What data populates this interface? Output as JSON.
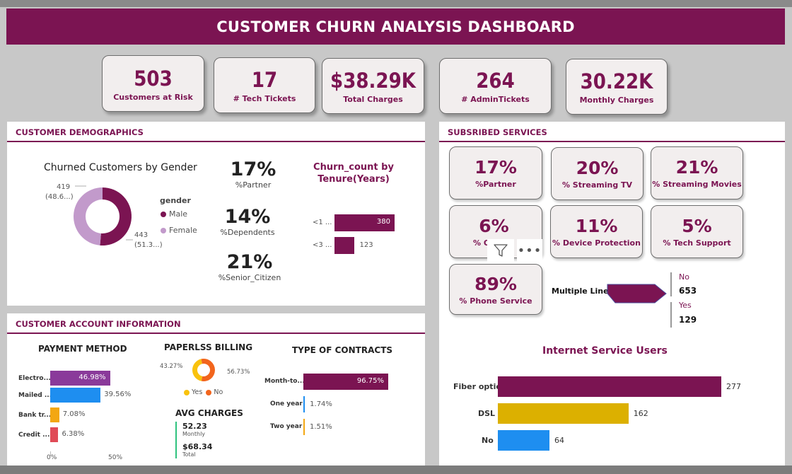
{
  "title": "CUSTOMER CHURN ANALYSIS DASHBOARD",
  "kpis": [
    {
      "value": "503",
      "label": "Customers at Risk"
    },
    {
      "value": "17",
      "label": "# Tech Tickets"
    },
    {
      "value": "$38.29K",
      "label": "Total Charges"
    },
    {
      "value": "264",
      "label": "# AdminTickets"
    },
    {
      "value": "30.22K",
      "label": "Monthly Charges"
    }
  ],
  "demographics": {
    "section_title": "CUSTOMER DEMOGRAPHICS",
    "gender_chart": {
      "title": "Churned Customers by Gender",
      "legend_title": "gender",
      "female_label_1": "419",
      "female_label_2": "(48.6...)",
      "male_label_1": "443",
      "male_label_2": "(51.3...)",
      "legend": [
        "Male",
        "Female"
      ]
    },
    "stats": [
      {
        "value": "17%",
        "label": "%Partner"
      },
      {
        "value": "14%",
        "label": "%Dependents"
      },
      {
        "value": "21%",
        "label": "%Senior_Citizen"
      }
    ],
    "tenure_chart": {
      "title_line1": "Churn_count by",
      "title_line2": "Tenure(Years)",
      "bars": [
        {
          "label": "<1 ...",
          "value_label": "380"
        },
        {
          "label": "<3 ...",
          "value_label": "123"
        }
      ]
    }
  },
  "account": {
    "section_title": "CUSTOMER ACCOUNT INFORMATION",
    "payment": {
      "title": "PAYMENT METHOD",
      "rows": [
        {
          "label": "Electro...",
          "value_label": "46.98%"
        },
        {
          "label": "Mailed ...",
          "value_label": "39.56%"
        },
        {
          "label": "Bank tr...",
          "value_label": "7.08%"
        },
        {
          "label": "Credit ...",
          "value_label": "6.38%"
        }
      ],
      "axis": [
        "0%",
        "50%"
      ]
    },
    "paperless": {
      "title": "PAPERLSS BILLING",
      "left_label": "43.27%",
      "right_label": "56.73%",
      "legend": [
        "Yes",
        "No"
      ]
    },
    "avg": {
      "title": "AVG CHARGES",
      "monthly_value": "52.23",
      "monthly_label": "Monthly",
      "total_value": "$68.34",
      "total_label": "Total"
    },
    "contracts": {
      "title": "TYPE OF CONTRACTS",
      "rows": [
        {
          "label": "Month-to...",
          "value_label": "96.75%"
        },
        {
          "label": "One year",
          "value_label": "1.74%"
        },
        {
          "label": "Two year",
          "value_label": "1.51%"
        }
      ]
    }
  },
  "services": {
    "section_title": "SUBSRIBED SERVICES",
    "cards": [
      {
        "value": "17%",
        "label": "%Partner"
      },
      {
        "value": "20%",
        "label": "% Streaming TV"
      },
      {
        "value": "21%",
        "label": "% Streaming Movies"
      },
      {
        "value": "6%",
        "label": "% O"
      },
      {
        "value": "11%",
        "label": "% Device Protection"
      },
      {
        "value": "5%",
        "label": "% Tech Support"
      },
      {
        "value": "89%",
        "label": "% Phone Service"
      }
    ],
    "multiple_lines": {
      "label": "Multiple Lines",
      "no_label": "No",
      "no_value": "653",
      "yes_label": "Yes",
      "yes_value": "129"
    },
    "internet": {
      "title": "Internet Service Users",
      "rows": [
        {
          "label": "Fiber optic",
          "value_label": "277"
        },
        {
          "label": "DSL",
          "value_label": "162"
        },
        {
          "label": "No",
          "value_label": "64"
        }
      ]
    }
  },
  "colors": {
    "brand": "#7b1452",
    "female": "#c29acb",
    "payment_1": "#8a3a9a",
    "payment_2": "#1e8ef0",
    "payment_3": "#f3a712",
    "payment_4": "#e04b57",
    "paper_yes": "#f9c20d",
    "paper_no": "#f2651d",
    "dsl": "#dcb000",
    "no_service": "#1e8ef0"
  },
  "chart_data": [
    {
      "type": "pie",
      "title": "Churned Customers by Gender",
      "categories": [
        "Male",
        "Female"
      ],
      "values": [
        443,
        419
      ]
    },
    {
      "type": "bar",
      "title": "Churn_count by Tenure(Years)",
      "categories": [
        "<1 ...",
        "<3 ..."
      ],
      "values": [
        380,
        123
      ]
    },
    {
      "type": "bar",
      "title": "PAYMENT METHOD",
      "categories": [
        "Electro...",
        "Mailed ...",
        "Bank tr...",
        "Credit ..."
      ],
      "values": [
        46.98,
        39.56,
        7.08,
        6.38
      ],
      "xlim": [
        0,
        50
      ]
    },
    {
      "type": "pie",
      "title": "PAPERLSS BILLING",
      "categories": [
        "Yes",
        "No"
      ],
      "values": [
        43.27,
        56.73
      ]
    },
    {
      "type": "bar",
      "title": "TYPE OF CONTRACTS",
      "categories": [
        "Month-to...",
        "One year",
        "Two year"
      ],
      "values": [
        96.75,
        1.74,
        1.51
      ]
    },
    {
      "type": "bar",
      "title": "Internet Service Users",
      "categories": [
        "Fiber optic",
        "DSL",
        "No"
      ],
      "values": [
        277,
        162,
        64
      ]
    }
  ]
}
